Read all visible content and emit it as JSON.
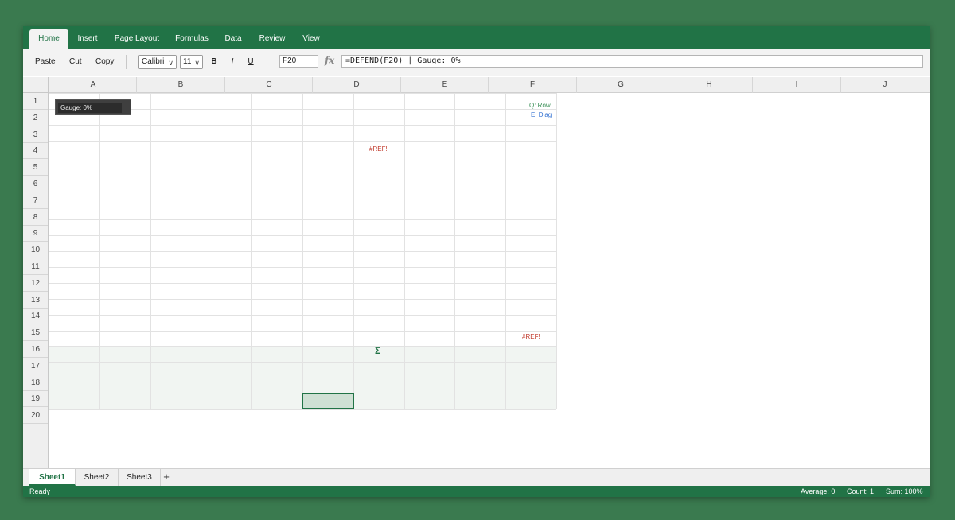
{
  "ribbon": {
    "tabs": [
      "Home",
      "Insert",
      "Page Layout",
      "Formulas",
      "Data",
      "Review",
      "View"
    ],
    "active_tab": "Home"
  },
  "toolbar": {
    "paste_label": "Paste",
    "cut_label": "Cut",
    "copy_label": "Copy",
    "font_name": "Calibri",
    "font_size": "11",
    "bold_label": "B",
    "italic_label": "I",
    "underline_label": "U"
  },
  "formula_bar": {
    "name_box": "F20",
    "fx_icon": "fx",
    "formula": "=DEFEND(F20) | Gauge: 0%"
  },
  "grid": {
    "columns": [
      "A",
      "B",
      "C",
      "D",
      "E",
      "F",
      "G",
      "H",
      "I",
      "J"
    ],
    "rows": [
      "1",
      "2",
      "3",
      "4",
      "5",
      "6",
      "7",
      "8",
      "9",
      "10",
      "11",
      "12",
      "13",
      "14",
      "15",
      "16",
      "17",
      "18",
      "19",
      "20"
    ],
    "selected_cell": "F20"
  },
  "cells": {
    "gauge_label": "Gauge: 0%",
    "gauge_value": 0,
    "gauge_accent": "#217346",
    "ref_error_1": "#REF!",
    "ref_error_2": "#REF!",
    "q_note": "Q: Row",
    "e_note": "E: Diag",
    "sigma_icon": "Σ",
    "error_color": "#c0392b",
    "q_color": "#3a8f57",
    "e_color": "#2f6fd1"
  },
  "sheets": {
    "tabs": [
      "Sheet1",
      "Sheet2",
      "Sheet3"
    ],
    "active": "Sheet1",
    "add_icon": "+"
  },
  "status": {
    "ready": "Ready",
    "average": "Average: 0",
    "count": "Count: 1",
    "sum": "Sum: 100%"
  },
  "colors": {
    "brand": "#217346",
    "background": "#3a7a4f"
  }
}
